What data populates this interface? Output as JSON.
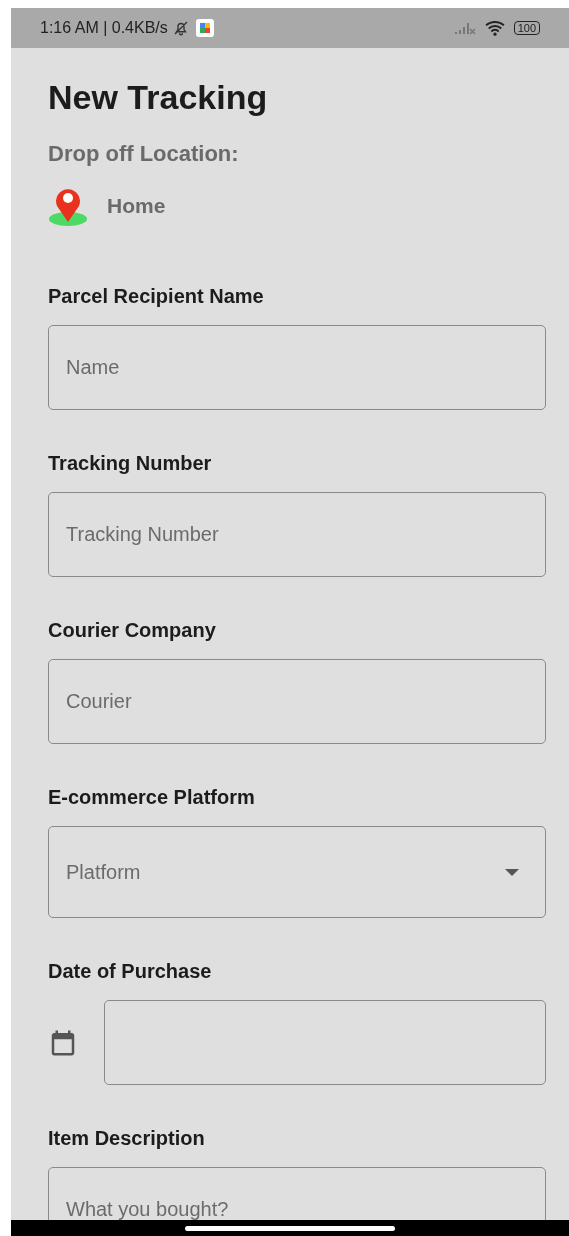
{
  "status_bar": {
    "time": "1:16 AM | 0.4KB/s",
    "battery": "100"
  },
  "title": "New Tracking",
  "drop_off": {
    "label": "Drop off Location:",
    "location": "Home"
  },
  "fields": [
    {
      "kind": "text",
      "label": "Parcel Recipient Name",
      "placeholder": "Name"
    },
    {
      "kind": "text",
      "label": "Tracking Number",
      "placeholder": "Tracking Number"
    },
    {
      "kind": "text",
      "label": "Courier Company",
      "placeholder": "Courier"
    },
    {
      "kind": "dropdown",
      "label": "E-commerce Platform",
      "placeholder": "Platform"
    },
    {
      "kind": "date",
      "label": "Date of Purchase"
    },
    {
      "kind": "textarea",
      "label": "Item Description",
      "placeholder": "What you bought?"
    }
  ]
}
